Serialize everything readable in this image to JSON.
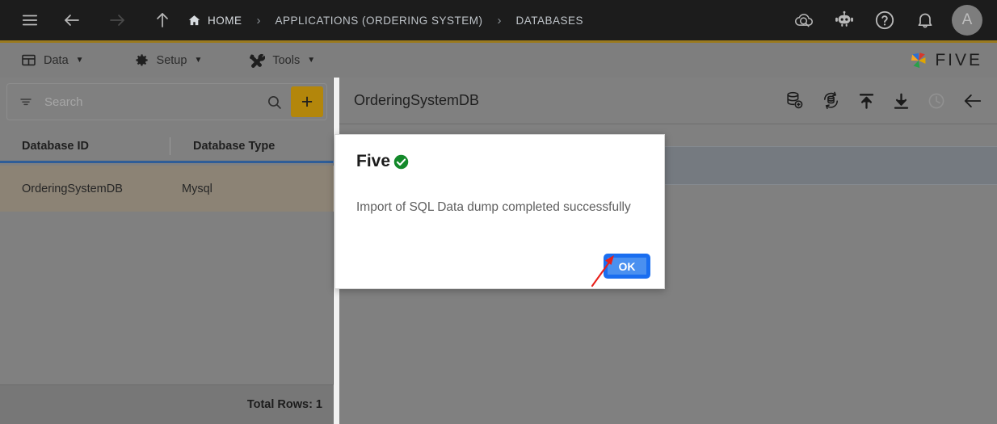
{
  "topbar": {
    "menu_icon": "hamburger-icon",
    "back_icon": "arrow-left-icon",
    "forward_icon": "arrow-right-icon",
    "up_icon": "arrow-up-icon",
    "breadcrumbs": [
      {
        "label": "HOME",
        "icon": "home-icon"
      },
      {
        "label": "APPLICATIONS (ORDERING SYSTEM)"
      },
      {
        "label": "DATABASES"
      }
    ],
    "separator": "›",
    "actions": [
      {
        "name": "cloud-search-icon"
      },
      {
        "name": "robot-assistant-icon"
      },
      {
        "name": "help-icon"
      },
      {
        "name": "notifications-bell-icon"
      }
    ],
    "avatar_initial": "A"
  },
  "menubar": {
    "items": [
      {
        "label": "Data",
        "icon": "grid-table-icon",
        "caret": "▼"
      },
      {
        "label": "Setup",
        "icon": "gear-icon",
        "caret": "▼"
      },
      {
        "label": "Tools",
        "icon": "tools-icon",
        "caret": "▼"
      }
    ],
    "brand": "FIVE"
  },
  "left_panel": {
    "search": {
      "placeholder": "Search",
      "value": "",
      "filter_icon": "filter-icon",
      "search_icon": "search-icon"
    },
    "add_button_label": "+",
    "table": {
      "columns": [
        "Database ID",
        "Database Type"
      ],
      "rows": [
        {
          "database_id": "OrderingSystemDB",
          "database_type": "Mysql"
        }
      ]
    },
    "footer": {
      "total_rows": "Total Rows: 1"
    }
  },
  "right_panel": {
    "title": "OrderingSystemDB",
    "tools": [
      {
        "name": "database-add-icon"
      },
      {
        "name": "database-sync-icon"
      },
      {
        "name": "upload-icon"
      },
      {
        "name": "download-icon"
      },
      {
        "name": "history-clock-icon"
      },
      {
        "name": "back-arrow-icon"
      }
    ]
  },
  "modal": {
    "title": "Five",
    "status_icon": "success-check-circle-icon",
    "message": "Import of SQL Data dump completed successfully",
    "ok_label": "OK"
  },
  "annotation": {
    "arrow": "red-arrow-pointing-to-ok-button",
    "color": "#e8201a"
  },
  "colors": {
    "topbar_bg": "#1c1c1c",
    "accent_gold": "#b3860b",
    "panel_bg": "#808080",
    "selected_row": "#8c8375",
    "header_underline": "#2f5d97",
    "primary_button": "#4a90f0",
    "success_green": "#13892a"
  }
}
